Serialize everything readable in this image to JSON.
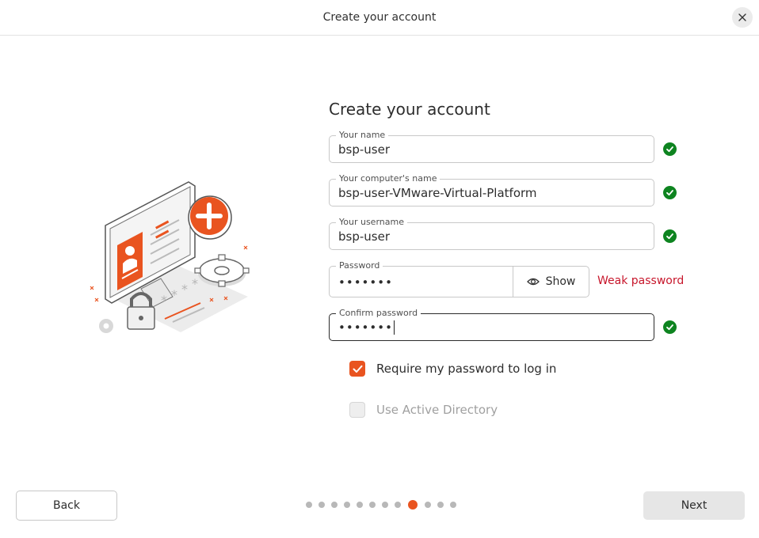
{
  "window": {
    "title": "Create your account"
  },
  "heading": "Create your account",
  "fields": {
    "name": {
      "label": "Your name",
      "value": "bsp-user"
    },
    "computer": {
      "label": "Your computer's name",
      "value": "bsp-user-VMware-Virtual-Platform"
    },
    "username": {
      "label": "Your username",
      "value": "bsp-user"
    },
    "password": {
      "label": "Password",
      "value": "•••••••",
      "show_label": "Show",
      "strength": "Weak password"
    },
    "confirm": {
      "label": "Confirm password",
      "value": "•••••••"
    }
  },
  "options": {
    "require_password": {
      "label": "Require my password to log in",
      "checked": true
    },
    "active_directory": {
      "label": "Use Active Directory",
      "checked": false,
      "enabled": false
    }
  },
  "nav": {
    "back_label": "Back",
    "next_label": "Next"
  },
  "progress": {
    "total_steps": 12,
    "current_step": 9
  },
  "colors": {
    "accent": "#e95420",
    "success": "#0e8420",
    "error": "#c7162b"
  },
  "icons": [
    "close-icon",
    "check-circle-icon",
    "eye-icon",
    "checkbox-check-icon",
    "account-security-illustration"
  ]
}
